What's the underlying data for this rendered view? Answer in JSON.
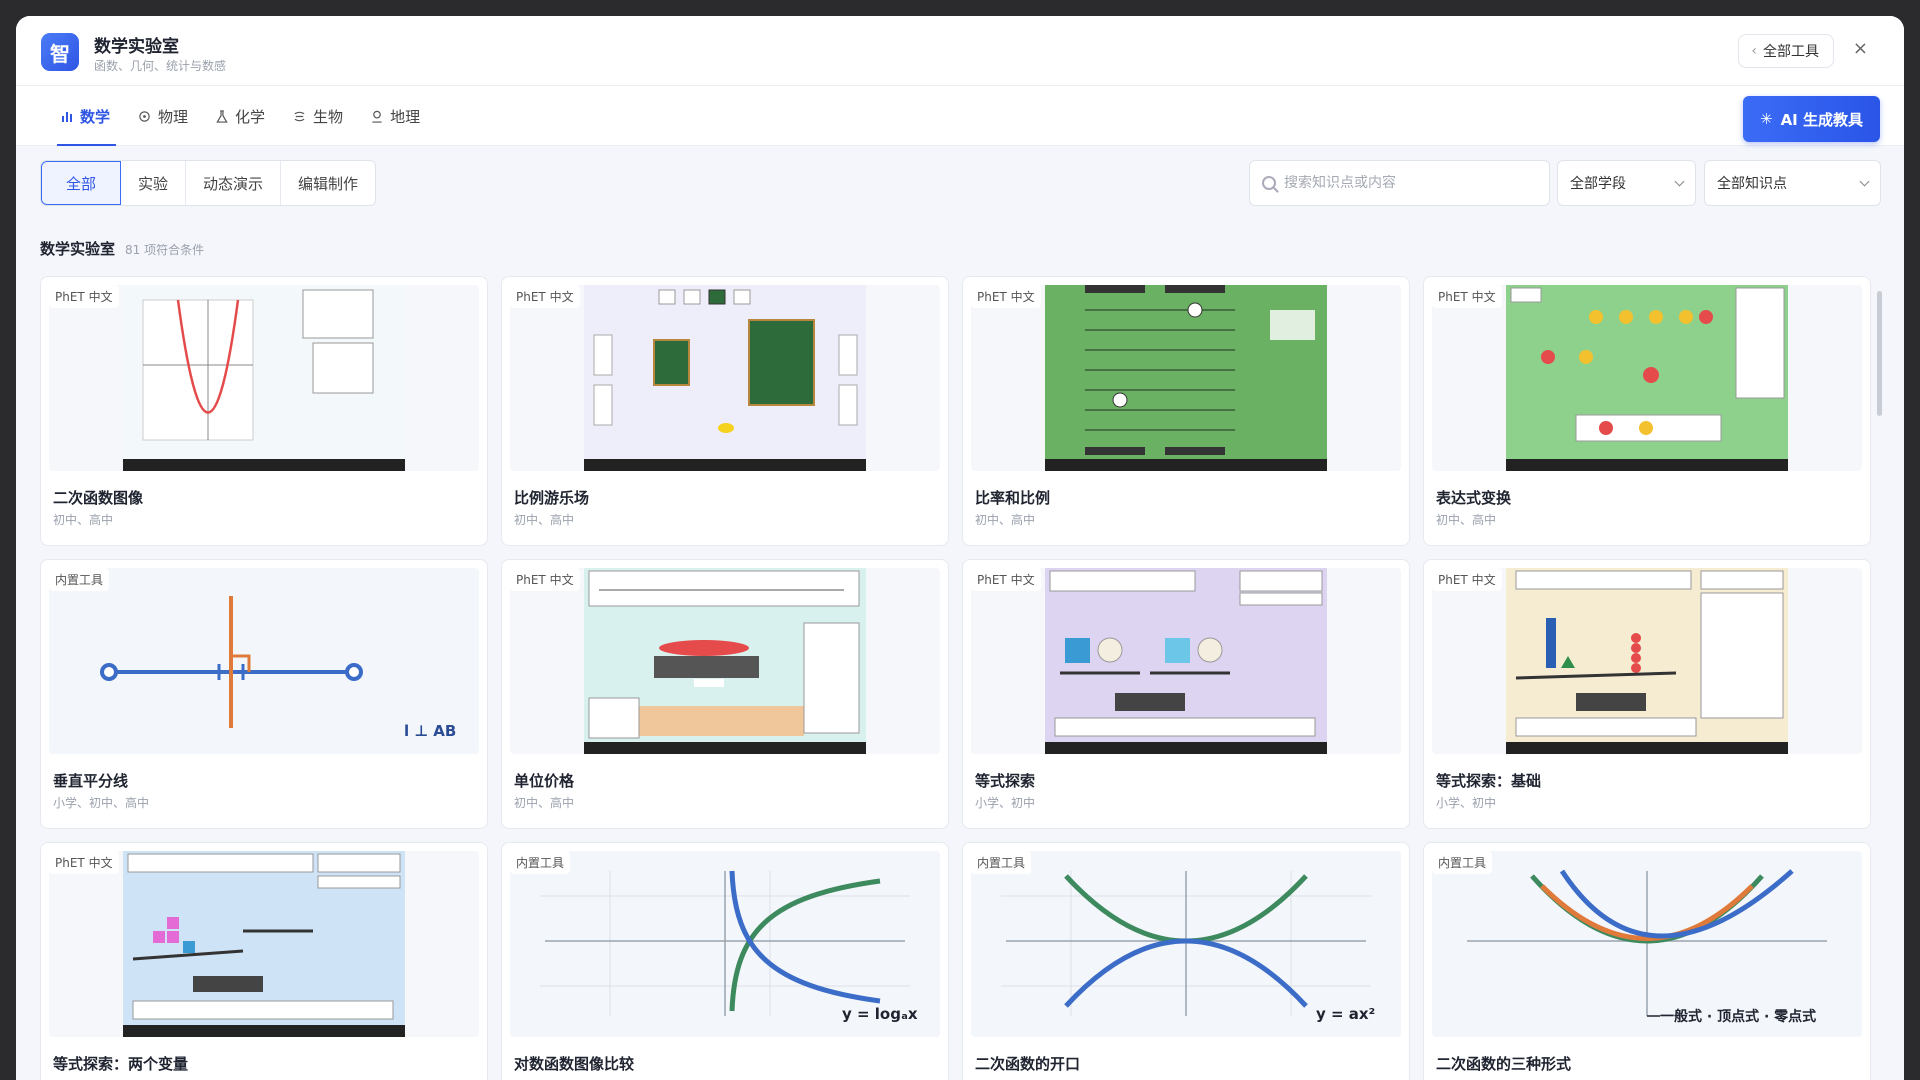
{
  "app": {
    "logo_char": "智",
    "title": "数学实验室",
    "subtitle": "函数、几何、统计与数感",
    "all_tools_label": "全部工具",
    "close_glyph": "×"
  },
  "subjects": [
    {
      "label": "数学",
      "icon": "bar-chart-icon",
      "active": true
    },
    {
      "label": "物理",
      "icon": "atom-icon",
      "active": false
    },
    {
      "label": "化学",
      "icon": "flask-icon",
      "active": false
    },
    {
      "label": "生物",
      "icon": "dna-icon",
      "active": false
    },
    {
      "label": "地理",
      "icon": "map-pin-icon",
      "active": false
    }
  ],
  "ai_button_label": "AI 生成教具",
  "filters": {
    "segments": [
      "全部",
      "实验",
      "动态演示",
      "编辑制作"
    ],
    "search_placeholder": "搜索知识点或内容",
    "stage_select": "全部学段",
    "knowledge_select": "全部知识点"
  },
  "section": {
    "title": "数学实验室",
    "count": "81 项符合条件"
  },
  "cards": [
    {
      "badge": "PhET 中文",
      "title": "二次函数图像",
      "sub": "初中、高中"
    },
    {
      "badge": "PhET 中文",
      "title": "比例游乐场",
      "sub": "初中、高中"
    },
    {
      "badge": "PhET 中文",
      "title": "比率和比例",
      "sub": "初中、高中"
    },
    {
      "badge": "PhET 中文",
      "title": "表达式变换",
      "sub": "初中、高中"
    },
    {
      "badge": "内置工具",
      "title": "垂直平分线",
      "sub": "小学、初中、高中",
      "label": "l ⊥ AB"
    },
    {
      "badge": "PhET 中文",
      "title": "单位价格",
      "sub": "初中、高中"
    },
    {
      "badge": "PhET 中文",
      "title": "等式探索",
      "sub": "小学、初中"
    },
    {
      "badge": "PhET 中文",
      "title": "等式探索：基础",
      "sub": "小学、初中"
    },
    {
      "badge": "PhET 中文",
      "title": "等式探索：两个变量",
      "sub": ""
    },
    {
      "badge": "内置工具",
      "title": "对数函数图像比较",
      "sub": "",
      "label": "y = logₐx"
    },
    {
      "badge": "内置工具",
      "title": "二次函数的开口",
      "sub": "",
      "label": "y = ax²"
    },
    {
      "badge": "内置工具",
      "title": "二次函数的三种形式",
      "sub": "",
      "label": "一般式 · 顶点式 · 零点式"
    }
  ],
  "colors": {
    "accent": "#2f55e4",
    "green": "#3d8a5f",
    "blue": "#3b6cc8",
    "orange": "#e07a3a"
  }
}
